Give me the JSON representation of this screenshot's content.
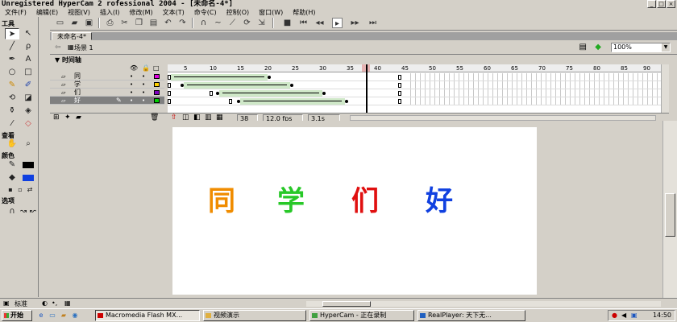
{
  "window": {
    "title": "Unregistered HyperCam 2 rofessional 2004 - [未命名-4*]",
    "controls": [
      "_",
      "□",
      "×"
    ]
  },
  "menu": [
    "文件(F)",
    "编辑(E)",
    "视图(V)",
    "插入(I)",
    "修改(M)",
    "文本(T)",
    "命令(C)",
    "控制(O)",
    "窗口(W)",
    "帮助(H)"
  ],
  "toolbar": {
    "icons": [
      "new-file-icon",
      "open-folder-icon",
      "save-icon",
      "print-icon",
      "cut-icon",
      "copy-icon",
      "paste-icon",
      "undo-icon",
      "redo-icon",
      "snap-magnet-icon",
      "smooth-icon",
      "straighten-icon",
      "rotate-icon",
      "scale-icon",
      "stop-icon",
      "rewind-icon",
      "step-back-icon",
      "play-icon",
      "step-forward-icon",
      "go-end-icon"
    ]
  },
  "tools_panel": {
    "tools_header": "工具",
    "view_header": "查看",
    "colors_header": "颜色",
    "options_header": "选项"
  },
  "document": {
    "tab": "未命名-4*",
    "scene": "场景 1",
    "zoom": "100%"
  },
  "timeline": {
    "title": "时间轴",
    "ruler": [
      "5",
      "10",
      "15",
      "20",
      "25",
      "30",
      "35",
      "40",
      "45",
      "50",
      "55",
      "60",
      "65",
      "70",
      "75",
      "80",
      "85",
      "90"
    ],
    "layers": [
      {
        "name": "同",
        "color": "#e000e0",
        "active": false
      },
      {
        "name": "学",
        "color": "#ffd000",
        "active": false
      },
      {
        "name": "们",
        "color": "#8000c0",
        "active": false
      },
      {
        "name": "好",
        "color": "#00d000",
        "active": true
      }
    ],
    "current_frame": "38",
    "fps": "12.0 fps",
    "time": "3.1s"
  },
  "stage": {
    "glyphs": [
      {
        "text": "同",
        "color": "#f08c00"
      },
      {
        "text": "学",
        "color": "#28c828"
      },
      {
        "text": "们",
        "color": "#e01010"
      },
      {
        "text": "好",
        "color": "#1040e0"
      }
    ]
  },
  "bottom": {
    "mode": "标准"
  },
  "taskbar": {
    "start": "开始",
    "tasks": [
      "Macromedia Flash MX...",
      "视频演示",
      "HyperCam - 正在录制",
      "RealPlayer: 天下无..."
    ],
    "clock": "14:50"
  }
}
